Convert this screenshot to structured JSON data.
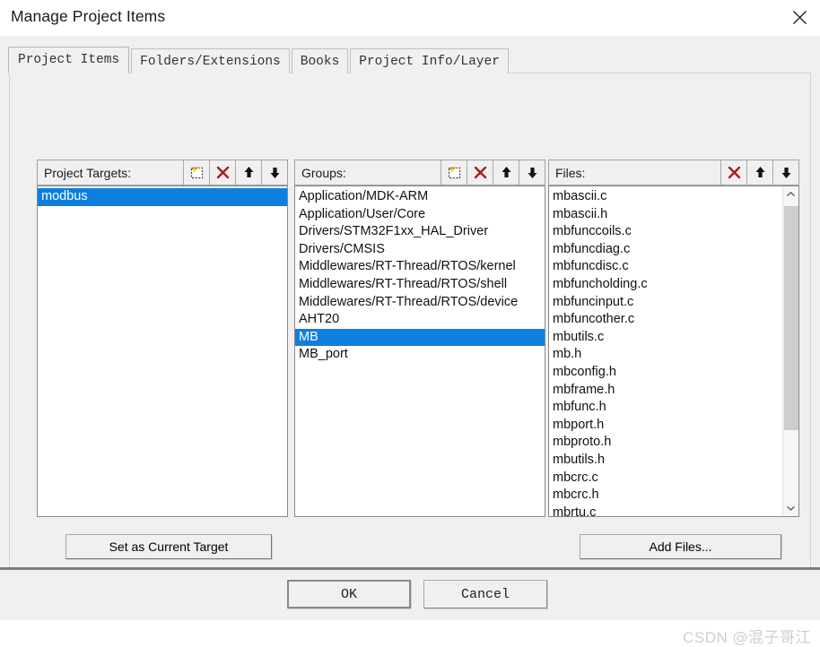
{
  "window": {
    "title": "Manage Project Items",
    "close_icon": "close-icon"
  },
  "tabs": [
    {
      "label": "Project Items",
      "selected": true
    },
    {
      "label": "Folders/Extensions",
      "selected": false
    },
    {
      "label": "Books",
      "selected": false
    },
    {
      "label": "Project Info/Layer",
      "selected": false
    }
  ],
  "colors": {
    "selection": "#0d7fe0",
    "dialog_bg": "#f0f0f0",
    "delete_icon": "#b01818",
    "new_icon_accent": "#ffd700"
  },
  "targets_panel": {
    "label": "Project Targets:",
    "buttons": [
      {
        "name": "new-item-icon",
        "title": "New"
      },
      {
        "name": "delete-icon",
        "title": "Delete"
      },
      {
        "name": "move-up-icon",
        "title": "Move Up"
      },
      {
        "name": "move-down-icon",
        "title": "Move Down"
      }
    ],
    "items": [
      {
        "label": "modbus",
        "selected": true
      }
    ]
  },
  "groups_panel": {
    "label": "Groups:",
    "buttons": [
      {
        "name": "new-item-icon",
        "title": "New"
      },
      {
        "name": "delete-icon",
        "title": "Delete"
      },
      {
        "name": "move-up-icon",
        "title": "Move Up"
      },
      {
        "name": "move-down-icon",
        "title": "Move Down"
      }
    ],
    "items": [
      {
        "label": "Application/MDK-ARM",
        "selected": false
      },
      {
        "label": "Application/User/Core",
        "selected": false
      },
      {
        "label": "Drivers/STM32F1xx_HAL_Driver",
        "selected": false
      },
      {
        "label": "Drivers/CMSIS",
        "selected": false
      },
      {
        "label": "Middlewares/RT-Thread/RTOS/kernel",
        "selected": false
      },
      {
        "label": "Middlewares/RT-Thread/RTOS/shell",
        "selected": false
      },
      {
        "label": "Middlewares/RT-Thread/RTOS/device",
        "selected": false
      },
      {
        "label": "AHT20",
        "selected": false
      },
      {
        "label": "MB",
        "selected": true
      },
      {
        "label": "MB_port",
        "selected": false
      }
    ]
  },
  "files_panel": {
    "label": "Files:",
    "buttons": [
      {
        "name": "delete-icon",
        "title": "Delete"
      },
      {
        "name": "move-up-icon",
        "title": "Move Up"
      },
      {
        "name": "move-down-icon",
        "title": "Move Down"
      }
    ],
    "items": [
      {
        "label": "mbascii.c",
        "selected": false
      },
      {
        "label": "mbascii.h",
        "selected": false
      },
      {
        "label": "mbfunccoils.c",
        "selected": false
      },
      {
        "label": "mbfuncdiag.c",
        "selected": false
      },
      {
        "label": "mbfuncdisc.c",
        "selected": false
      },
      {
        "label": "mbfuncholding.c",
        "selected": false
      },
      {
        "label": "mbfuncinput.c",
        "selected": false
      },
      {
        "label": "mbfuncother.c",
        "selected": false
      },
      {
        "label": "mbutils.c",
        "selected": false
      },
      {
        "label": "mb.h",
        "selected": false
      },
      {
        "label": "mbconfig.h",
        "selected": false
      },
      {
        "label": "mbframe.h",
        "selected": false
      },
      {
        "label": "mbfunc.h",
        "selected": false
      },
      {
        "label": "mbport.h",
        "selected": false
      },
      {
        "label": "mbproto.h",
        "selected": false
      },
      {
        "label": "mbutils.h",
        "selected": false
      },
      {
        "label": "mbcrc.c",
        "selected": false
      },
      {
        "label": "mbcrc.h",
        "selected": false
      },
      {
        "label": "mbrtu.c",
        "selected": false
      }
    ],
    "scrollbar": {
      "up_icon": "chevron-up-icon",
      "down_icon": "chevron-down-icon"
    }
  },
  "actions": {
    "set_as_current_target": "Set as Current Target",
    "add_files": "Add Files..."
  },
  "footer": {
    "ok": "OK",
    "cancel": "Cancel"
  },
  "watermark": {
    "prefix": "CSDN ",
    "handle": "@混子哥江"
  }
}
